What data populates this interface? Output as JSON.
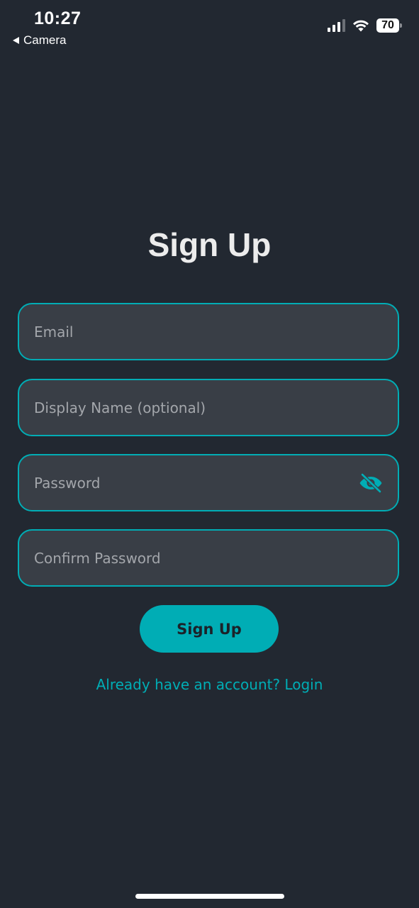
{
  "status_bar": {
    "time": "10:27",
    "back_app": "Camera",
    "battery": "70"
  },
  "page": {
    "title": "Sign Up"
  },
  "form": {
    "email_placeholder": "Email",
    "display_name_placeholder": "Display Name (optional)",
    "password_placeholder": "Password",
    "confirm_password_placeholder": "Confirm Password",
    "submit_label": "Sign Up",
    "login_link": "Already have an account? Login"
  },
  "icons": {
    "password_toggle": "eye-off-icon"
  },
  "colors": {
    "background": "#222831",
    "field_background": "#393e46",
    "accent": "#00adb5"
  }
}
